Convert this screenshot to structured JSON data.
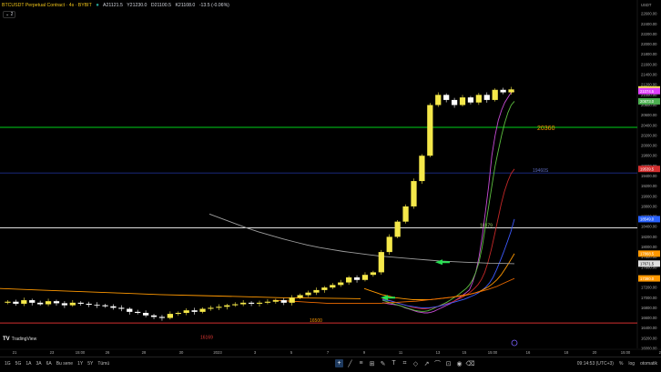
{
  "header": {
    "title": "BTCUSDT Perpetual Contract · 4s · BYBIT",
    "open": "A21121.5",
    "high": "Y21230.0",
    "low": "D21100.5",
    "close": "K21108.0",
    "change": "-13.5 (-0.06%)",
    "indicators_count": "2",
    "currency": "USDT"
  },
  "logo_text": "TradingView",
  "toolbar": {
    "ranges": [
      "1G",
      "5G",
      "1A",
      "3A",
      "6A",
      "Bu sene",
      "1Y",
      "5Y",
      "Tümü"
    ],
    "time": "09:14:53 (UTC+3)",
    "percent": "%",
    "log": "log",
    "auto": "otomatik"
  },
  "colors": {
    "up": "#f5e84a",
    "down": "#ffffff",
    "bg": "#000000",
    "green_line": "#00d11a",
    "blue_line": "#1e2e8c",
    "red_line": "#d32f2f"
  },
  "chart_data": {
    "type": "candlestick",
    "symbol": "BTCUSDT Perpetual Contract",
    "interval": "4s",
    "exchange": "BYBIT",
    "y_axis": {
      "range": [
        16000,
        22800
      ],
      "ticks": [
        16000,
        16200,
        16400,
        16600,
        16800,
        17000,
        17200,
        17400,
        17600,
        17800,
        18000,
        18200,
        18400,
        18600,
        18800,
        19000,
        19200,
        19400,
        19600,
        19800,
        20000,
        20200,
        20400,
        20600,
        20800,
        21000,
        21200,
        21400,
        21600,
        21800,
        22000,
        22200,
        22400,
        22600
      ]
    },
    "x_axis": {
      "ticks": [
        "21",
        "23",
        "15:00",
        "26",
        "28",
        "30",
        "2023",
        "3",
        "5",
        "7",
        "9",
        "11",
        "13",
        "15",
        "15:00",
        "16",
        "18",
        "20",
        "15:00",
        "23"
      ]
    },
    "price_tags": [
      {
        "value": "21108.0",
        "color": "#f5e84a"
      },
      {
        "value": "21074.5",
        "color": "#e040fb"
      },
      {
        "value": "20873.0",
        "color": "#4caf50"
      },
      {
        "value": "19539.5",
        "color": "#d32f2f"
      },
      {
        "value": "18549.0",
        "color": "#2962ff"
      },
      {
        "value": "17868.5",
        "color": "#ff9800"
      },
      {
        "value": "17671.5",
        "color": "#e0e0e0"
      },
      {
        "value": "17380.0",
        "color": "#ff9800"
      }
    ],
    "annotations": [
      {
        "text": "20360",
        "value": 20360,
        "color": "#ff9800"
      },
      {
        "text": "19460S",
        "value": 19460,
        "color": "#5c6bc0"
      },
      {
        "text": "18379",
        "value": 18379,
        "color": "#9ccc65"
      },
      {
        "text": "16500",
        "value": 16500,
        "color": "#ff9800"
      },
      {
        "text": "16169",
        "value": 16169,
        "color": "#e53935"
      }
    ],
    "horizontal_lines": [
      {
        "value": 20360,
        "color": "#00d11a"
      },
      {
        "value": 19460,
        "color": "#1e2e8c"
      },
      {
        "value": 18379,
        "color": "#ffffff"
      },
      {
        "value": 16500,
        "color": "#d32f2f"
      }
    ],
    "series": [
      {
        "name": "price",
        "values": [
          16920,
          16880,
          16950,
          16900,
          16870,
          16930,
          16890,
          16850,
          16900,
          16880,
          16860,
          16850,
          16830,
          16800,
          16780,
          16720,
          16700,
          16650,
          16620,
          16600,
          16680,
          16700,
          16750,
          16720,
          16780,
          16800,
          16820,
          16850,
          16870,
          16900,
          16880,
          16900,
          16920,
          16950,
          16900,
          17000,
          17050,
          17100,
          17150,
          17200,
          17250,
          17300,
          17400,
          17350,
          17450,
          17500,
          17900,
          18200,
          18500,
          18800,
          19300,
          19800,
          20800,
          21000,
          20900,
          20800,
          20950,
          20850,
          21000,
          20900,
          21100,
          21050,
          21108
        ]
      },
      {
        "name": "ma_magenta",
        "values": [
          16900,
          16890,
          16880,
          16870,
          16860,
          16850,
          16830,
          16800,
          16780,
          16760,
          16740,
          16720,
          16710,
          16700,
          16700,
          16710,
          16730,
          16760,
          16790,
          16820,
          16850,
          16880,
          16920,
          16960,
          17000,
          17050,
          17100,
          17150,
          17300,
          17500,
          17800,
          18200,
          18700,
          19200,
          19800,
          20200,
          20500,
          20700,
          20850,
          20950,
          21050,
          21074
        ]
      },
      {
        "name": "ma_green",
        "values": [
          16950,
          16930,
          16910,
          16890,
          16870,
          16850,
          16830,
          16810,
          16790,
          16770,
          16750,
          16740,
          16730,
          16730,
          16740,
          16760,
          16790,
          16820,
          16850,
          16880,
          16910,
          16950,
          16990,
          17030,
          17080,
          17130,
          17180,
          17250,
          17350,
          17500,
          17700,
          18000,
          18400,
          18800,
          19200,
          19600,
          19900,
          20200,
          20450,
          20650,
          20800,
          20873
        ]
      },
      {
        "name": "ma_red",
        "values": [
          16980,
          16970,
          16950,
          16930,
          16910,
          16890,
          16870,
          16850,
          16830,
          16810,
          16800,
          16790,
          16780,
          16780,
          16790,
          16800,
          16810,
          16830,
          16850,
          16870,
          16890,
          16910,
          16940,
          16970,
          17000,
          17040,
          17080,
          17130,
          17190,
          17260,
          17360,
          17500,
          17700,
          17950,
          18250,
          18550,
          18850,
          19100,
          19300,
          19450,
          19539
        ]
      },
      {
        "name": "ma_blue",
        "values": [
          16960,
          16950,
          16940,
          16920,
          16900,
          16880,
          16860,
          16840,
          16830,
          16820,
          16810,
          16800,
          16800,
          16800,
          16810,
          16820,
          16830,
          16850,
          16870,
          16890,
          16910,
          16930,
          16950,
          16970,
          17000,
          17030,
          17060,
          17100,
          17150,
          17210,
          17290,
          17400,
          17550,
          17720,
          17900,
          18100,
          18300,
          18549
        ]
      },
      {
        "name": "ma_orange1",
        "values": [
          17180,
          17150,
          17120,
          17090,
          17060,
          17040,
          17020,
          17000,
          16990,
          16980,
          16970,
          16960,
          16960,
          16960,
          16960,
          16960,
          16970,
          16980,
          16990,
          17000,
          17010,
          17020,
          17030,
          17050,
          17070,
          17090,
          17120,
          17160,
          17210,
          17270,
          17350,
          17450,
          17580,
          17720,
          17868
        ]
      },
      {
        "name": "ma_white",
        "values": [
          18650,
          18560,
          18470,
          18380,
          18300,
          18230,
          18160,
          18100,
          18040,
          17990,
          17950,
          17910,
          17880,
          17850,
          17820,
          17800,
          17780,
          17760,
          17740,
          17720,
          17710,
          17700,
          17690,
          17680,
          17675,
          17671
        ]
      },
      {
        "name": "ma_orange2",
        "values": [
          16950,
          16940,
          16930,
          16920,
          16910,
          16900,
          16890,
          16890,
          16890,
          16890,
          16890,
          16890,
          16890,
          16900,
          16910,
          16920,
          16930,
          16950,
          16970,
          16990,
          17010,
          17040,
          17070,
          17110,
          17160,
          17220,
          17300,
          17380
        ]
      }
    ]
  }
}
